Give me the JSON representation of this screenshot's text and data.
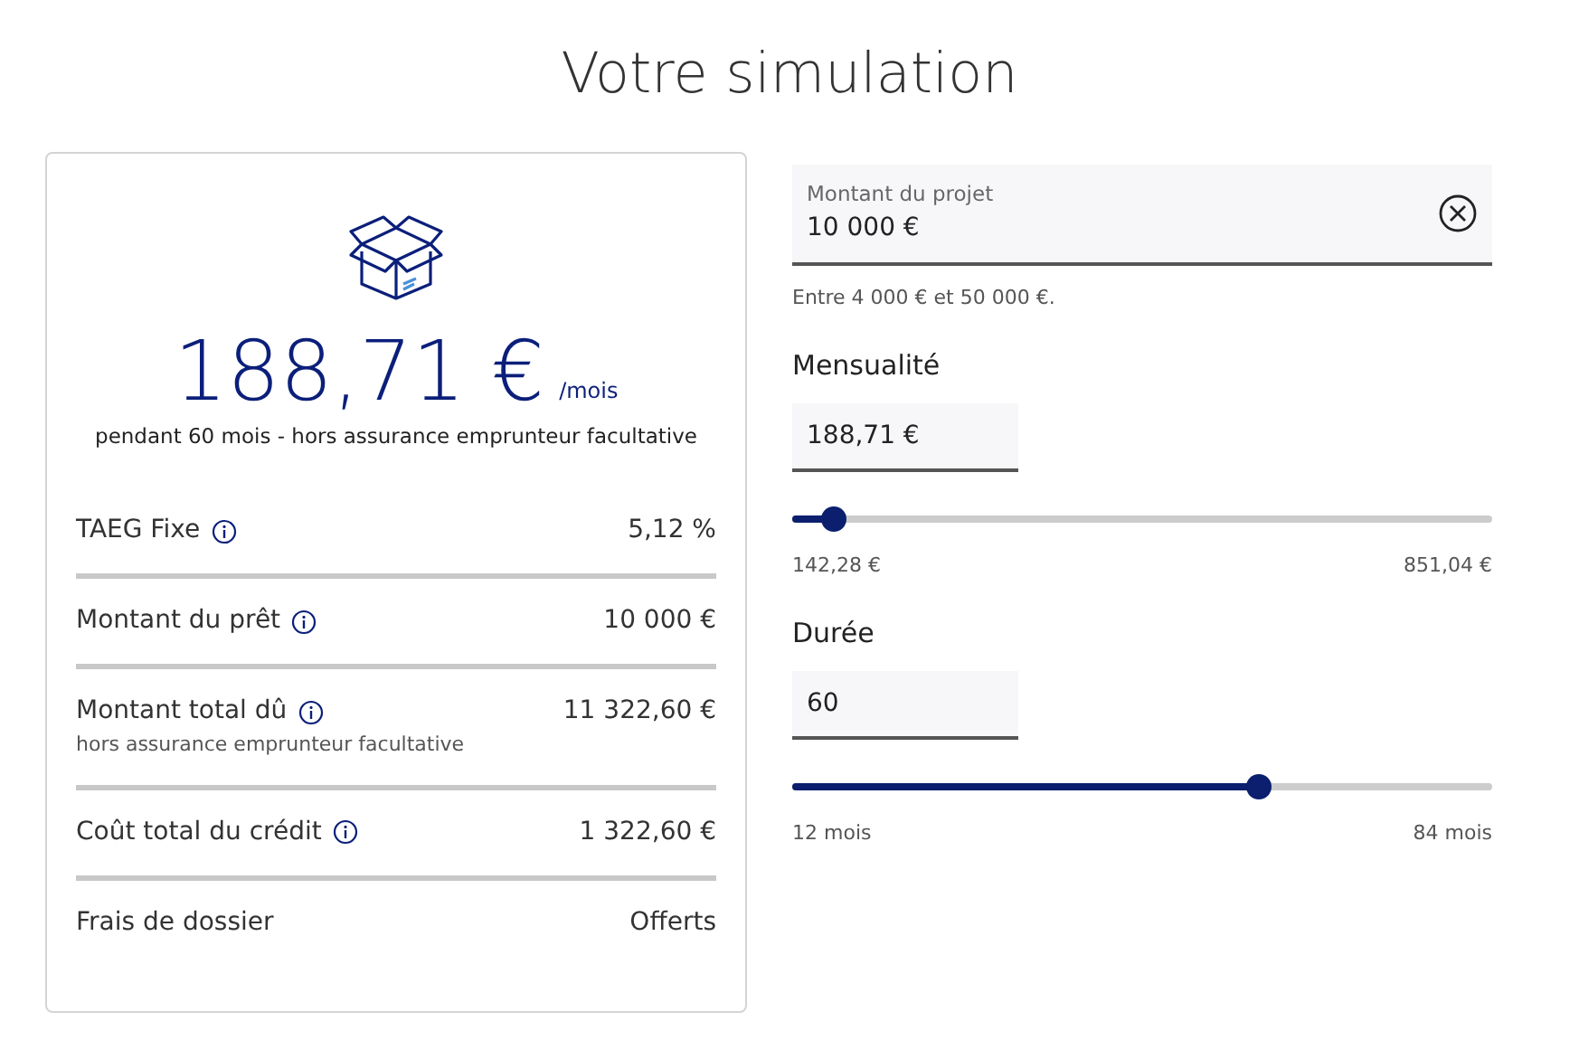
{
  "title": "Votre simulation",
  "summary": {
    "amount": "188,71 €",
    "unit": "/mois",
    "note": "pendant 60 mois - hors assurance emprunteur facultative",
    "rows": [
      {
        "label": "TAEG Fixe",
        "info": true,
        "value": "5,12 %"
      },
      {
        "label": "Montant du prêt",
        "info": true,
        "value": "10 000 €"
      },
      {
        "label": "Montant total dû",
        "info": true,
        "value": "11 322,60 €",
        "sub": "hors assurance emprunteur facultative"
      },
      {
        "label": "Coût total du crédit",
        "info": true,
        "value": "1 322,60 €"
      },
      {
        "label": "Frais de dossier",
        "info": false,
        "value": "Offerts"
      }
    ]
  },
  "project": {
    "label": "Montant du projet",
    "value": "10 000 €",
    "hint": "Entre 4 000 € et 50 000 €."
  },
  "sliders": [
    {
      "label": "Mensualité",
      "value": "188,71 €",
      "level": 0.06,
      "min": "142,28 €",
      "max": "851,04 €"
    },
    {
      "label": "Durée",
      "value": "60",
      "level": 0.667,
      "min": "12 mois",
      "max": "84 mois"
    }
  ]
}
